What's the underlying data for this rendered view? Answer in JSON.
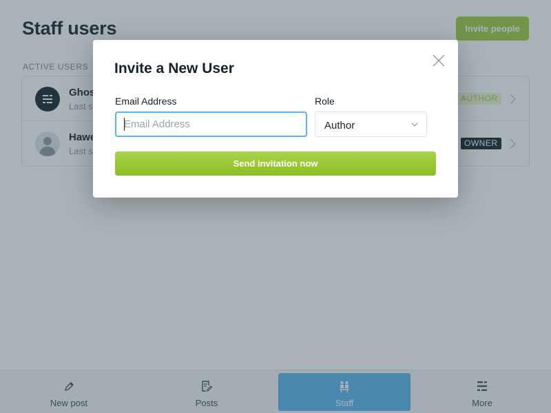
{
  "page": {
    "title": "Staff users",
    "invite_button": "Invite people",
    "section_label": "ACTIVE USERS"
  },
  "users": [
    {
      "name": "Ghost",
      "sub": "Last seen",
      "role": "AUTHOR",
      "avatar_icon": "ghost-logo-icon"
    },
    {
      "name": "Hawes",
      "sub": "Last seen",
      "role": "OWNER",
      "avatar_icon": "person-silhouette-icon"
    }
  ],
  "bottom_nav": [
    {
      "label": "New post",
      "icon": "pencil-icon"
    },
    {
      "label": "Posts",
      "icon": "document-edit-icon"
    },
    {
      "label": "Staff",
      "icon": "staff-icon",
      "active": true
    },
    {
      "label": "More",
      "icon": "more-menu-icon"
    }
  ],
  "modal": {
    "title": "Invite a New User",
    "email_label": "Email Address",
    "email_value": "",
    "email_placeholder": "Email Address",
    "role_label": "Role",
    "role_value": "Author",
    "send_button": "Send invitation now"
  },
  "colors": {
    "accent_green": "#9fcc40",
    "active_blue": "#58b4f0",
    "dark": "#15212a"
  }
}
